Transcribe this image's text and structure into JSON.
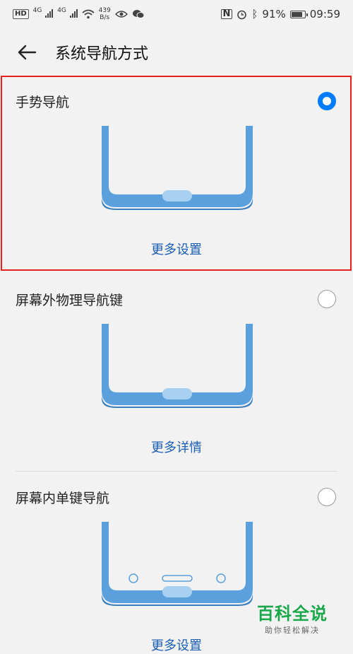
{
  "status_bar": {
    "hd_badge": "HD",
    "signal_1": "4G",
    "signal_2": "4G",
    "speed_value": "439",
    "speed_unit": "B/s",
    "battery_percent": "91%",
    "battery_level": 0.91,
    "time": "09:59",
    "icons": [
      "signal-icon",
      "wifi-icon",
      "eye-icon",
      "wechat-icon",
      "nfc-icon",
      "alarm-icon",
      "bluetooth-icon",
      "battery-icon"
    ]
  },
  "header": {
    "title": "系统导航方式",
    "back_icon": "arrow-left-icon"
  },
  "options": [
    {
      "title": "手势导航",
      "link": "更多设置",
      "selected": true
    },
    {
      "title": "屏幕外物理导航键",
      "link": "更多详情",
      "selected": false
    },
    {
      "title": "屏幕内单键导航",
      "link": "更多设置",
      "selected": false
    }
  ],
  "colors": {
    "accent": "#007dff",
    "link": "#1a5fb4",
    "phone": "#5aa0dc",
    "phone_dark": "#3a7fc1",
    "highlight_border": "#e82020"
  },
  "watermark": {
    "logo": "百科全说",
    "subtitle": "助你轻松解决"
  }
}
